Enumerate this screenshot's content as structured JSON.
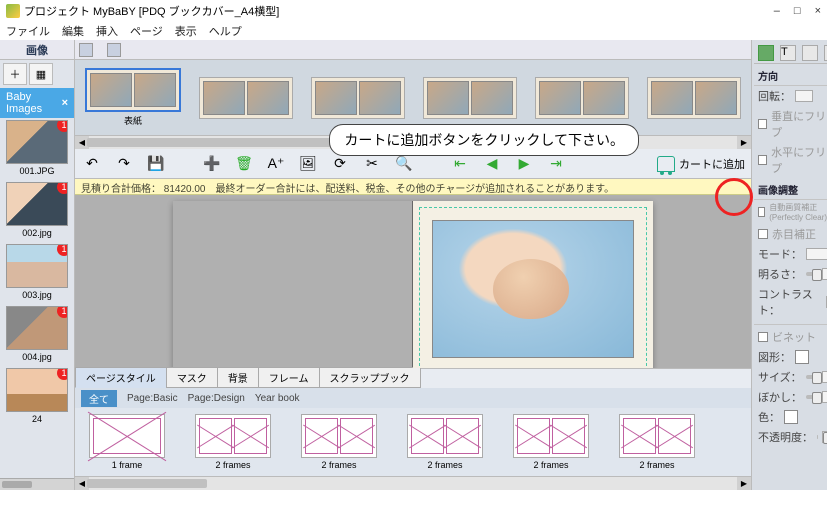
{
  "window": {
    "title": "プロジェクト MyBaBY [PDQ ブックカバー_A4横型]"
  },
  "win_controls": {
    "min": "–",
    "max": "□",
    "close": "×"
  },
  "menu": [
    "ファイル",
    "編集",
    "挿入",
    "ページ",
    "表示",
    "ヘルプ"
  ],
  "left": {
    "section_label": "画像",
    "album_tab": "Baby Images",
    "items": [
      {
        "label": "001.JPG",
        "badge": "1"
      },
      {
        "label": "002.jpg",
        "badge": "1"
      },
      {
        "label": "003.jpg",
        "badge": "1"
      },
      {
        "label": "004.jpg",
        "badge": "1"
      },
      {
        "label": "24",
        "badge": "1"
      }
    ]
  },
  "spreads": {
    "cover_label": "表紙"
  },
  "callout": "カートに追加ボタンをクリックして下さい。",
  "cart_label": "カートに追加",
  "price_bar": "見積り合計価格：  81420.00　最終オーダー合計には、配送料、税金、その他のチャージが追加されることがあります。",
  "bottom_tabs": [
    "ページスタイル",
    "マスク",
    "背景",
    "フレーム",
    "スクラップブック"
  ],
  "style_bar": {
    "all": "全て",
    "items": [
      "Page:Basic",
      "Page:Design",
      "Year book"
    ]
  },
  "frame_items": [
    "1 frame",
    "2 frames",
    "2 frames",
    "2 frames",
    "2 frames",
    "2 frames"
  ],
  "right": {
    "section1": "方向",
    "rotate": "回転：",
    "flip_v": "垂直にフリップ",
    "flip_h": "水平にフリップ",
    "section2": "画像調整",
    "auto": "自動画質補正 (Perfectly Clear)",
    "redeye": "赤目補正",
    "mode": "モード：",
    "brightness": "明るさ：",
    "contrast": "コントラスト：",
    "vignette": "ビネット",
    "shape": "図形：",
    "size": "サイズ：",
    "blur": "ぼかし：",
    "color": "色：",
    "opacity": "不透明度："
  }
}
